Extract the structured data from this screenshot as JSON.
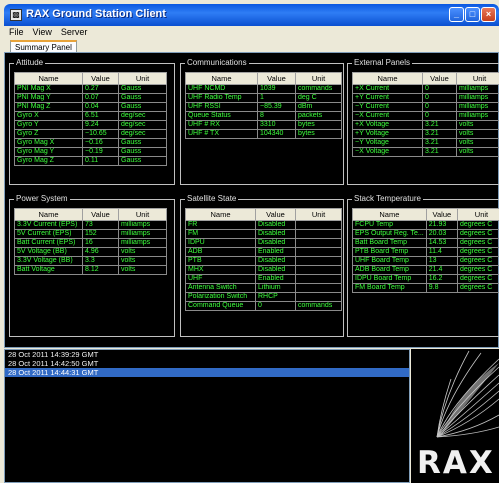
{
  "window": {
    "title": "RAX Ground Station Client"
  },
  "menu": [
    "File",
    "View",
    "Server"
  ],
  "tabs": [
    "Summary Panel"
  ],
  "panels": {
    "attitude": {
      "title": "Attitude",
      "headers": [
        "Name",
        "Value",
        "Unit"
      ],
      "rows": [
        [
          "PNI Mag X",
          "0.27",
          "Gauss"
        ],
        [
          "PNI Mag Y",
          "0.07",
          "Gauss"
        ],
        [
          "PNI Mag Z",
          "0.04",
          "Gauss"
        ],
        [
          "Gyro X",
          "6.51",
          "deg/sec"
        ],
        [
          "Gyro Y",
          "9.24",
          "deg/sec"
        ],
        [
          "Gyro Z",
          "−10.65",
          "deg/sec"
        ],
        [
          "Gyro Mag X",
          "−0.16",
          "Gauss"
        ],
        [
          "Gyro Mag Y",
          "−0.19",
          "Gauss"
        ],
        [
          "Gyro Mag Z",
          "0.11",
          "Gauss"
        ]
      ]
    },
    "communications": {
      "title": "Communications",
      "headers": [
        "Name",
        "Value",
        "Unit"
      ],
      "rows": [
        [
          "UHF NCMD",
          "1039",
          "commands"
        ],
        [
          "UHF Radio Temp",
          "1",
          "deg C"
        ],
        [
          "UHF RSSI",
          "−85.39",
          "dBm"
        ],
        [
          "Queue Status",
          "8",
          "packets"
        ],
        [
          "UHF # RX",
          "3310",
          "bytes"
        ],
        [
          "UHF # TX",
          "104340",
          "bytes"
        ]
      ]
    },
    "external_panels": {
      "title": "External Panels",
      "headers": [
        "Name",
        "Value",
        "Unit"
      ],
      "rows": [
        [
          "+X Current",
          "0",
          "milliamps"
        ],
        [
          "+Y Current",
          "0",
          "milliamps"
        ],
        [
          "−Y Current",
          "0",
          "milliamps"
        ],
        [
          "−X Current",
          "0",
          "milliamps"
        ],
        [
          "+X Voltage",
          "3.21",
          "volts"
        ],
        [
          "+Y Voltage",
          "3.21",
          "volts"
        ],
        [
          "−Y Voltage",
          "3.21",
          "volts"
        ],
        [
          "−X Voltage",
          "3.21",
          "volts"
        ]
      ]
    },
    "power_system": {
      "title": "Power System",
      "headers": [
        "Name",
        "Value",
        "Unit"
      ],
      "rows": [
        [
          "3.3V Current (EPS)",
          "73",
          "milliamps"
        ],
        [
          "5V Current (EPS)",
          "152",
          "milliamps"
        ],
        [
          "Batt Current (EPS)",
          "16",
          "milliamps"
        ],
        [
          "5V Voltage (BB)",
          "4.96",
          "volts"
        ],
        [
          "3.3V Voltage (BB)",
          "3.3",
          "volts"
        ],
        [
          "Batt Voltage",
          "8.12",
          "volts"
        ]
      ]
    },
    "satellite_state": {
      "title": "Satellite State",
      "headers": [
        "Name",
        "Value",
        "Unit"
      ],
      "rows": [
        [
          "FR",
          "Disabled",
          ""
        ],
        [
          "FM",
          "Disabled",
          ""
        ],
        [
          "IDPU",
          "Disabled",
          ""
        ],
        [
          "ADB",
          "Enabled",
          ""
        ],
        [
          "PTB",
          "Disabled",
          ""
        ],
        [
          "MHX",
          "Disabled",
          ""
        ],
        [
          "UHF",
          "Enabled",
          ""
        ],
        [
          "Antenna Switch",
          "Lithium",
          ""
        ],
        [
          "Polarization Switch",
          "RHCP",
          ""
        ],
        [
          "Command Queue",
          "0",
          "commands"
        ]
      ]
    },
    "stack_temperature": {
      "title": "Stack Temperature",
      "headers": [
        "Name",
        "Value",
        "Unit"
      ],
      "rows": [
        [
          "FCPU Temp",
          "21.93",
          "degrees C"
        ],
        [
          "EPS Output Reg. Te...",
          "20.03",
          "degrees C"
        ],
        [
          "Batt Board Temp",
          "14.53",
          "degrees C"
        ],
        [
          "PTB Board Temp",
          "11.4",
          "degrees C"
        ],
        [
          "UHF Board Temp",
          "13",
          "degrees C"
        ],
        [
          "ADB Board Temp",
          "21.4",
          "degrees C"
        ],
        [
          "IDPU Board Temp",
          "16.2",
          "degrees C"
        ],
        [
          "FM Board Temp",
          "9.8",
          "degrees C"
        ]
      ]
    }
  },
  "log": {
    "entries": [
      "28 Oct 2011 14:39:29 GMT",
      "28 Oct 2011 14:42:50 GMT",
      "28 Oct 2011 14:44:31 GMT"
    ],
    "selected_index": 2
  },
  "logo": {
    "text": "RAX"
  },
  "colors": {
    "value_text": "#3cff3c",
    "panel_bg": "#000000",
    "selection": "#316ac5",
    "titlebar": "#0a58e0"
  }
}
